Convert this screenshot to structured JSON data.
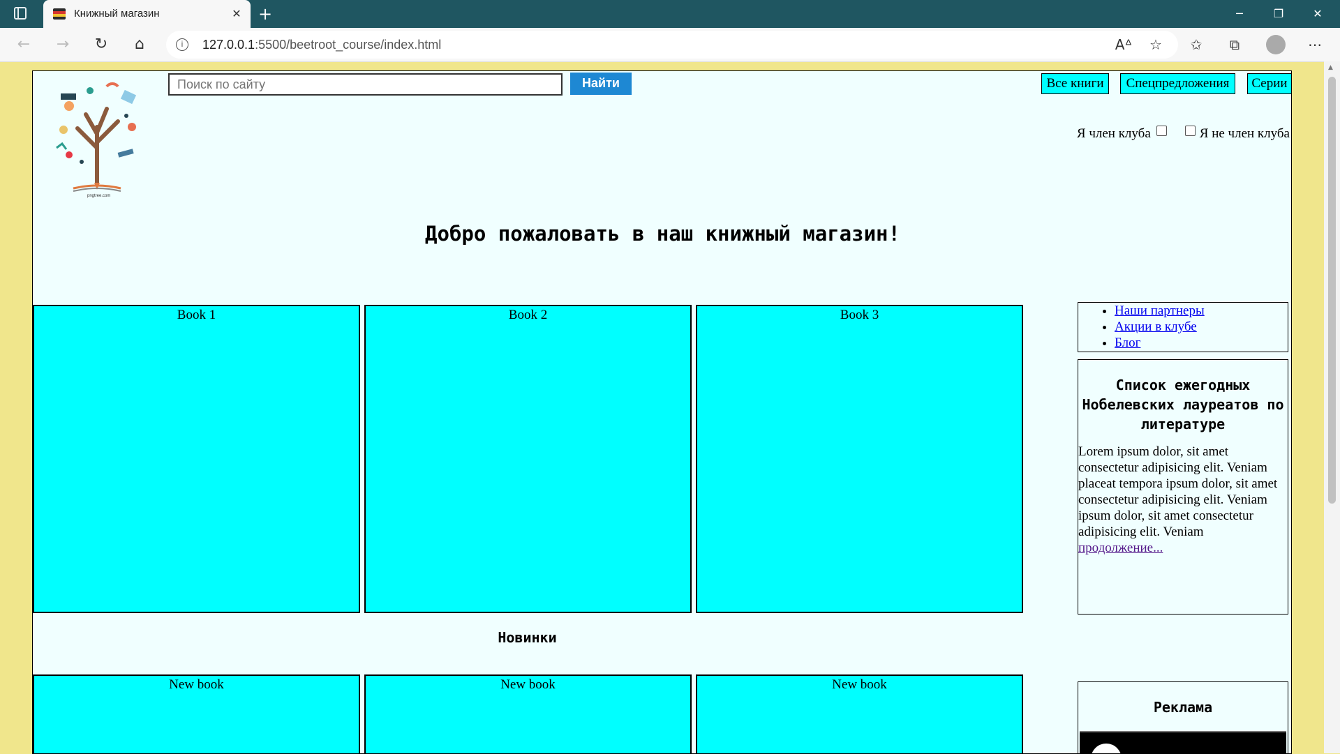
{
  "browser": {
    "tab_title": "Книжный магазин",
    "tab_close": "✕",
    "new_tab": "+",
    "url_host": "127.0.0.1",
    "url_path": ":5500/beetroot_course/index.html",
    "window_buttons": {
      "minimize": "─",
      "restore": "❐",
      "close": "✕"
    },
    "nav_icons": {
      "back": "←",
      "forward": "→",
      "reload": "↻",
      "home": "⌂"
    },
    "tool_icons": {
      "read_aloud": "Aᐞ",
      "add_favorite": "☆",
      "favorites": "✩",
      "collections": "⧉",
      "more": "⋯"
    }
  },
  "site": {
    "search": {
      "placeholder": "Поиск по сайту",
      "button": "Найти"
    },
    "nav": [
      "Все книги",
      "Спецпредложения",
      "Серии"
    ],
    "club": {
      "member": "Я член клуба",
      "non_member": "Я не член клуба"
    },
    "welcome": "Добро пожаловать в наш книжный магазин!",
    "books": [
      "Book 1",
      "Book 2",
      "Book 3"
    ],
    "new_heading": "Новинки",
    "new_books": [
      "New book",
      "New book",
      "New book"
    ],
    "side_links": [
      "Наши партнеры",
      "Акции в клубе",
      "Блог"
    ],
    "nobel": {
      "title": "Список ежегодных Нобелевских лауреатов по литературе",
      "text": "Lorem ipsum dolor, sit amet consectetur adipisicing elit. Veniam placeat tempora ipsum dolor, sit amet consectetur adipisicing elit. Veniam ipsum dolor, sit amet consectetur adipisicing elit. Veniam",
      "more": "продолжение..."
    },
    "ad_title": "Реклама",
    "logo_caption": "pngtree.com"
  },
  "colors": {
    "page_bg": "#f0e68c",
    "content_bg": "#f0ffff",
    "book_bg": "#00ffff",
    "search_button": "#1e88d3",
    "browser_frame": "#1f5661"
  }
}
